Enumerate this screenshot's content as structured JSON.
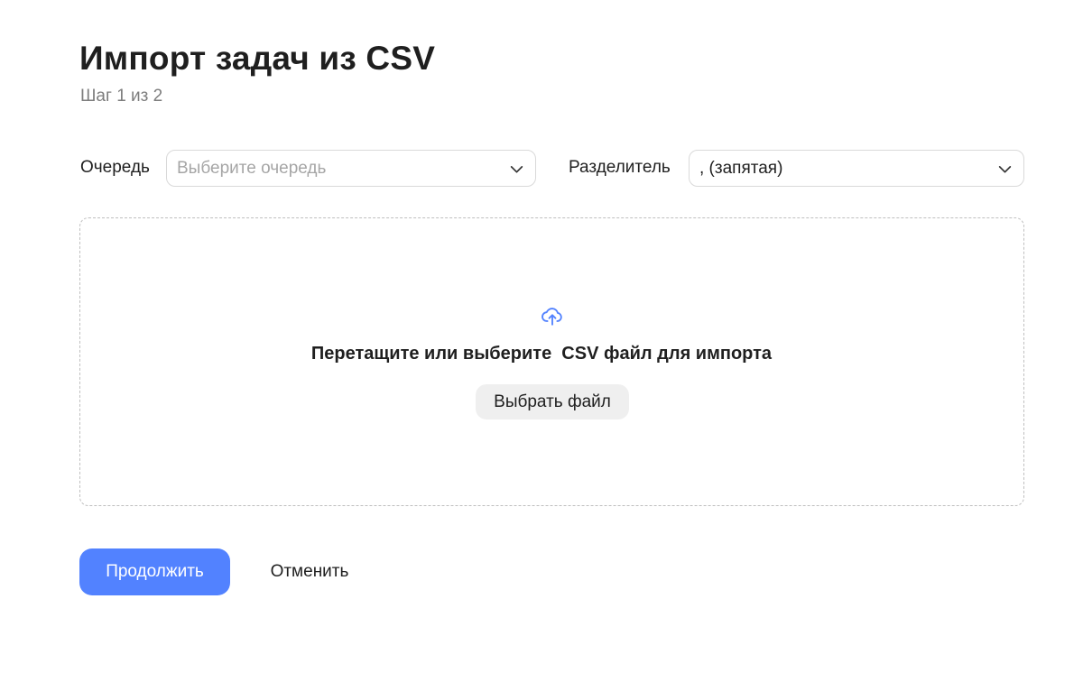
{
  "header": {
    "title": "Импорт задач из CSV",
    "step": "Шаг 1 из 2"
  },
  "form": {
    "queue": {
      "label": "Очередь",
      "placeholder": "Выберите очередь",
      "value": ""
    },
    "separator": {
      "label": "Разделитель",
      "value": ", (запятая)"
    }
  },
  "dropzone": {
    "icon": "upload-cloud-icon",
    "text": "Перетащите или выберите  CSV файл для импорта",
    "button_label": "Выбрать файл"
  },
  "actions": {
    "continue_label": "Продолжить",
    "cancel_label": "Отменить"
  },
  "colors": {
    "primary": "#5282ff",
    "icon_accent": "#5282ff",
    "muted_text": "#7d7d7d",
    "placeholder": "#a6a6a6"
  }
}
